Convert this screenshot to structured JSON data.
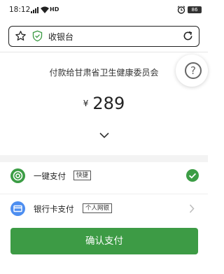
{
  "status_bar": {
    "time": "18:12",
    "network": "HD",
    "battery": "86"
  },
  "url_bar": {
    "title": "收银台"
  },
  "payment": {
    "payee": "付款给甘肃省卫生健康委员会",
    "currency": "¥",
    "amount": "289"
  },
  "help": {
    "label": "?"
  },
  "methods": [
    {
      "label": "一键支付",
      "tag": "快捷",
      "selected": true,
      "icon": "quick-pay-icon"
    },
    {
      "label": "银行卡支付",
      "tag": "个人网银",
      "selected": false,
      "icon": "bank-card-icon"
    }
  ],
  "confirm_button": {
    "label": "确认支付"
  },
  "colors": {
    "brand_green": "#3d9b45",
    "card_blue": "#4d8ef0"
  }
}
